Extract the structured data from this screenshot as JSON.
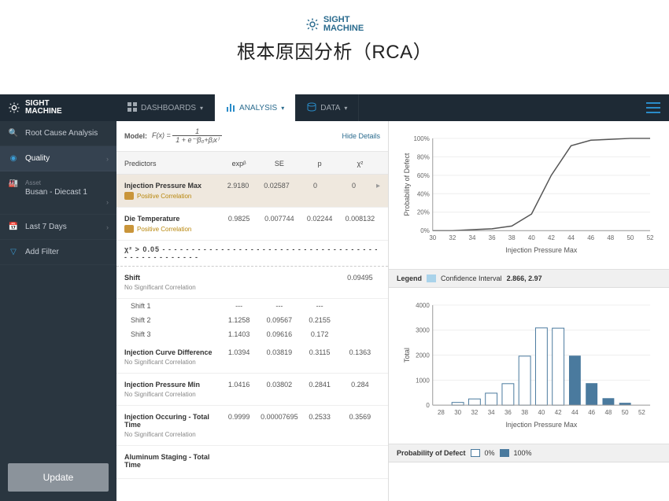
{
  "brand": {
    "line1": "SIGHT",
    "line2": "MACHINE"
  },
  "page_title": "根本原因分析（RCA）",
  "nav": {
    "tabs": [
      {
        "label": "DASHBOARDS",
        "icon": "grid-icon"
      },
      {
        "label": "ANALYSIS",
        "icon": "bars-icon",
        "active": true
      },
      {
        "label": "DATA",
        "icon": "db-icon"
      }
    ]
  },
  "sidebar": {
    "items": [
      {
        "label": "Root Cause Analysis",
        "icon": "search-icon"
      },
      {
        "label": "Quality",
        "icon": "gauge-icon",
        "active": true,
        "chevron": true
      },
      {
        "sub": "Asset",
        "label": "Busan - Diecast 1",
        "icon": "factory-icon",
        "chevron": true
      },
      {
        "label": "Last 7 Days",
        "icon": "calendar-icon",
        "chevron": true
      },
      {
        "label": "Add Filter",
        "icon": "funnel-icon"
      }
    ],
    "update_btn": "Update"
  },
  "model": {
    "label": "Model:",
    "formula_lhs": "F(x) = ",
    "formula_num": "1",
    "formula_den": "1 + e⁻⁽β₀+βⱼx⁾",
    "hide_details": "Hide Details"
  },
  "columns": {
    "name": "Predictors",
    "c1": "expᵝ",
    "c2": "SE",
    "c3": "p",
    "c4": "χ²"
  },
  "predictors": [
    {
      "title": "Injection Pressure Max",
      "corr": "Positive Correlation",
      "corr_type": "positive",
      "v": [
        "2.9180",
        "0.02587",
        "0",
        "0"
      ],
      "selected": true,
      "arrow": true
    },
    {
      "title": "Die Temperature",
      "corr": "Positive Correlation",
      "corr_type": "positive",
      "v": [
        "0.9825",
        "0.007744",
        "0.02244",
        "0.008132"
      ]
    }
  ],
  "divider": "χ² > 0.05 - - - - - - - - - - - - - - - - - - - - - - - - - - - - - - - - - - - - - - - - - - - - - - - - - -",
  "predictors2": [
    {
      "title": "Shift",
      "corr": "No Significant Correlation",
      "corr_type": "none",
      "v": [
        "",
        "",
        "",
        "0.09495"
      ],
      "subrows": [
        {
          "name": "Shift 1",
          "v": [
            "---",
            "---",
            "---",
            ""
          ]
        },
        {
          "name": "Shift 2",
          "v": [
            "1.1258",
            "0.09567",
            "0.2155",
            ""
          ]
        },
        {
          "name": "Shift 3",
          "v": [
            "1.1403",
            "0.09616",
            "0.172",
            ""
          ]
        }
      ]
    },
    {
      "title": "Injection Curve Difference",
      "corr": "No Significant Correlation",
      "corr_type": "none",
      "v": [
        "1.0394",
        "0.03819",
        "0.3115",
        "0.1363"
      ]
    },
    {
      "title": "Injection Pressure Min",
      "corr": "No Significant Correlation",
      "corr_type": "none",
      "v": [
        "1.0416",
        "0.03802",
        "0.2841",
        "0.284"
      ]
    },
    {
      "title": "Injection Occuring - Total Time",
      "corr": "No Significant Correlation",
      "corr_type": "none",
      "v": [
        "0.9999",
        "0.00007695",
        "0.2533",
        "0.3569"
      ]
    },
    {
      "title": "Aluminum Staging - Total Time",
      "corr": "",
      "corr_type": "none",
      "v": [
        "",
        "",
        "",
        ""
      ]
    }
  ],
  "charts": {
    "legend_label": "Legend",
    "ci_label": "Confidence Interval",
    "ci_value": "2.866, 2.97",
    "prob_label": "Probability of Defect",
    "zero_label": "0%",
    "full_label": "100%",
    "xlabel": "Injection Pressure Max",
    "ylabel_top": "Probability of Defect",
    "ylabel_bottom": "Total"
  },
  "chart_data": [
    {
      "type": "line",
      "title": "",
      "xlabel": "Injection Pressure Max",
      "ylabel": "Probability of Defect",
      "x": [
        30,
        32,
        34,
        36,
        38,
        40,
        42,
        44,
        46,
        48,
        50,
        52
      ],
      "y_percent": [
        0,
        0,
        1,
        2,
        5,
        18,
        60,
        92,
        98,
        99,
        100,
        100
      ],
      "ylim": [
        0,
        100
      ],
      "yticks": [
        0,
        20,
        40,
        60,
        80,
        100
      ],
      "ytick_labels": [
        "0%",
        "20%",
        "40%",
        "60%",
        "80%",
        "100%"
      ]
    },
    {
      "type": "bar",
      "title": "",
      "xlabel": "Injection Pressure Max",
      "ylabel": "Total",
      "categories": [
        28,
        30,
        32,
        34,
        36,
        38,
        40,
        42,
        44,
        46,
        48,
        50,
        52
      ],
      "series": [
        {
          "name": "0%",
          "values": [
            0,
            110,
            250,
            480,
            860,
            1960,
            3090,
            3080,
            0,
            0,
            0,
            0,
            0
          ]
        },
        {
          "name": "100%",
          "values": [
            0,
            0,
            0,
            0,
            0,
            0,
            0,
            0,
            1980,
            880,
            280,
            95,
            0
          ]
        }
      ],
      "ylim": [
        0,
        4000
      ],
      "yticks": [
        0,
        1000,
        2000,
        3000,
        4000
      ],
      "ci": [
        2.866,
        2.97
      ]
    }
  ]
}
